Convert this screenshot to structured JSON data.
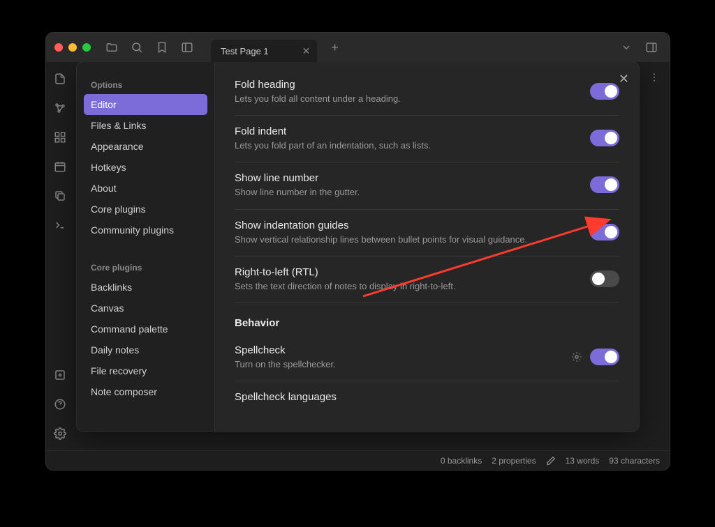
{
  "tab": {
    "title": "Test Page 1"
  },
  "sidebar": {
    "section1_header": "Options",
    "items1": [
      "Editor",
      "Files & Links",
      "Appearance",
      "Hotkeys",
      "About",
      "Core plugins",
      "Community plugins"
    ],
    "active_index": 0,
    "section2_header": "Core plugins",
    "items2": [
      "Backlinks",
      "Canvas",
      "Command palette",
      "Daily notes",
      "File recovery",
      "Note composer"
    ]
  },
  "settings": [
    {
      "title": "Fold heading",
      "desc": "Lets you fold all content under a heading.",
      "on": true
    },
    {
      "title": "Fold indent",
      "desc": "Lets you fold part of an indentation, such as lists.",
      "on": true
    },
    {
      "title": "Show line number",
      "desc": "Show line number in the gutter.",
      "on": true
    },
    {
      "title": "Show indentation guides",
      "desc": "Show vertical relationship lines between bullet points for visual guidance.",
      "on": true
    },
    {
      "title": "Right-to-left (RTL)",
      "desc": "Sets the text direction of notes to display in right-to-left.",
      "on": false
    }
  ],
  "behavior_header": "Behavior",
  "spellcheck": {
    "title": "Spellcheck",
    "desc": "Turn on the spellchecker.",
    "on": true
  },
  "spellcheck_lang": {
    "title": "Spellcheck languages"
  },
  "status": {
    "backlinks": "0 backlinks",
    "properties": "2 properties",
    "words": "13 words",
    "characters": "93 characters"
  }
}
